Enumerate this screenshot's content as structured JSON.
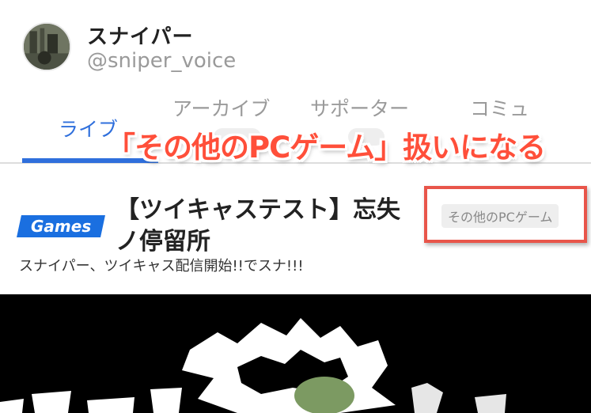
{
  "profile": {
    "name": "スナイパー",
    "handle": "@sniper_voice"
  },
  "tabs": [
    {
      "label": "ライブ",
      "active": true
    },
    {
      "label": "アーカイブ",
      "active": false
    },
    {
      "label": "サポーター",
      "active": false
    },
    {
      "label": "コミュ",
      "active": false
    }
  ],
  "overlay": {
    "caption": "「その他のPCゲーム」扱いになる"
  },
  "stream": {
    "badge": "Games",
    "title": "【ツイキャステスト】忘失ノ停留所",
    "category": "その他のPCゲーム",
    "subtitle": "スナイパー、ツイキャス配信開始!!でスナ!!!"
  },
  "colors": {
    "accent": "#2f6fdc",
    "badge": "#1a6fe0",
    "highlight_frame": "#e8554a",
    "caption": "#ff4f3a"
  }
}
